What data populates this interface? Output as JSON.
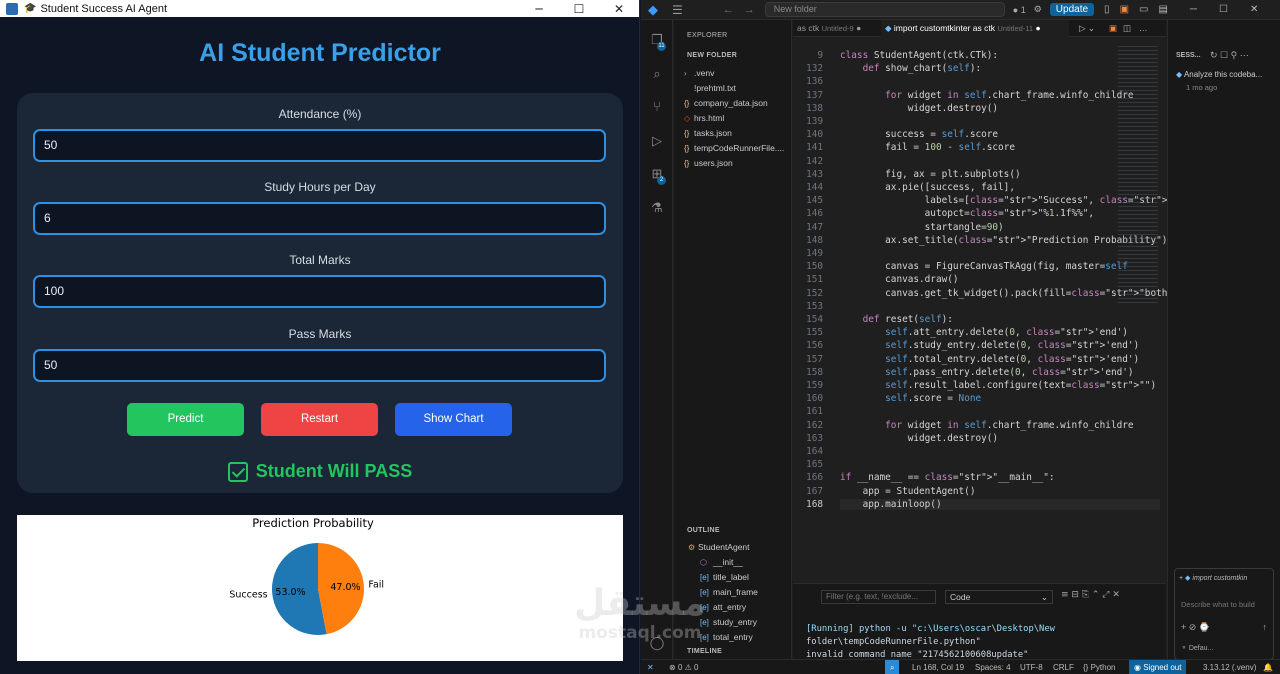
{
  "app": {
    "window_title": "Student Success AI Agent",
    "title": "AI Student Predictor",
    "fields": [
      {
        "label": "Attendance (%)",
        "value": "50"
      },
      {
        "label": "Study Hours per Day",
        "value": "6"
      },
      {
        "label": "Total Marks",
        "value": "100"
      },
      {
        "label": "Pass Marks",
        "value": "50"
      }
    ],
    "buttons": {
      "predict": "Predict",
      "restart": "Restart",
      "chart": "Show Chart"
    },
    "result": "Student Will PASS",
    "colors": {
      "accent": "#3aa0e8",
      "success": "#22c55e",
      "danger": "#ef4444",
      "primary": "#2563eb"
    }
  },
  "chart_data": {
    "type": "pie",
    "title": "Prediction Probability",
    "categories": [
      "Success",
      "Fail"
    ],
    "values": [
      53.0,
      47.0
    ],
    "value_labels": [
      "53.0%",
      "47.0%"
    ],
    "colors": [
      "#1f77b4",
      "#ff7f0e"
    ],
    "startangle": 90
  },
  "vscode": {
    "search": "New folder",
    "update_label": "Update",
    "tabs": [
      {
        "name": "as ctk",
        "sub": "Untitled-9"
      },
      {
        "name": "import customtkinter as ctk",
        "sub": "Untitled-11"
      }
    ],
    "explorer": {
      "header": "EXPLORER",
      "folder": "NEW FOLDER",
      "files": [
        ".venv",
        "!prehtml.txt",
        "company_data.json",
        "hrs.html",
        "tasks.json",
        "tempCodeRunnerFile....",
        "users.json"
      ]
    },
    "outline": {
      "header": "OUTLINE",
      "root": "StudentAgent",
      "items": [
        "__init__",
        "title_label",
        "main_frame",
        "att_entry",
        "study_entry",
        "total_entry"
      ],
      "timeline": "TIMELINE"
    },
    "code_lines": [
      {
        "n": "9",
        "t": "class StudentAgent(ctk.CTk):"
      },
      {
        "n": "132",
        "t": "    def show_chart(self):"
      },
      {
        "n": "136",
        "t": ""
      },
      {
        "n": "137",
        "t": "        for widget in self.chart_frame.winfo_childre"
      },
      {
        "n": "138",
        "t": "            widget.destroy()"
      },
      {
        "n": "139",
        "t": ""
      },
      {
        "n": "140",
        "t": "        success = self.score"
      },
      {
        "n": "141",
        "t": "        fail = 100 - self.score"
      },
      {
        "n": "142",
        "t": ""
      },
      {
        "n": "143",
        "t": "        fig, ax = plt.subplots()"
      },
      {
        "n": "144",
        "t": "        ax.pie([success, fail],"
      },
      {
        "n": "145",
        "t": "               labels=[\"Success\", \"Fail\"],"
      },
      {
        "n": "146",
        "t": "               autopct=\"%1.1f%%\","
      },
      {
        "n": "147",
        "t": "               startangle=90)"
      },
      {
        "n": "148",
        "t": "        ax.set_title(\"Prediction Probability\")"
      },
      {
        "n": "149",
        "t": ""
      },
      {
        "n": "150",
        "t": "        canvas = FigureCanvasTkAgg(fig, master=self"
      },
      {
        "n": "151",
        "t": "        canvas.draw()"
      },
      {
        "n": "152",
        "t": "        canvas.get_tk_widget().pack(fill=\"both\", exp"
      },
      {
        "n": "153",
        "t": ""
      },
      {
        "n": "154",
        "t": "    def reset(self):"
      },
      {
        "n": "155",
        "t": "        self.att_entry.delete(0, 'end')"
      },
      {
        "n": "156",
        "t": "        self.study_entry.delete(0, 'end')"
      },
      {
        "n": "157",
        "t": "        self.total_entry.delete(0, 'end')"
      },
      {
        "n": "158",
        "t": "        self.pass_entry.delete(0, 'end')"
      },
      {
        "n": "159",
        "t": "        self.result_label.configure(text=\"\")"
      },
      {
        "n": "160",
        "t": "        self.score = None"
      },
      {
        "n": "161",
        "t": ""
      },
      {
        "n": "162",
        "t": "        for widget in self.chart_frame.winfo_childre"
      },
      {
        "n": "163",
        "t": "            widget.destroy()"
      },
      {
        "n": "164",
        "t": ""
      },
      {
        "n": "165",
        "t": ""
      },
      {
        "n": "166",
        "t": "if __name__ == \"__main__\":"
      },
      {
        "n": "167",
        "t": "    app = StudentAgent()"
      },
      {
        "n": "168",
        "t": "    app.mainloop()"
      }
    ],
    "terminal": {
      "filter_placeholder": "Filter (e.g. text, !exclude...",
      "select": "Code",
      "lines": [
        "[Running] python -u \"c:\\Users\\oscar\\Desktop\\New",
        "folder\\tempCodeRunnerFile.python\"",
        "invalid command name \"2174562100608update\""
      ]
    },
    "chat": {
      "header": "SESS...",
      "session": "Analyze this codeba...",
      "time": "1 mo ago",
      "chip": "import customtkin",
      "placeholder": "Describe what to build",
      "mode": "Defau..."
    },
    "status": {
      "errors": "0",
      "warnings": "0",
      "position": "Ln 168, Col 19",
      "spaces": "Spaces: 4",
      "encoding": "UTF-8",
      "eol": "CRLF",
      "language": "Python",
      "signed": "Signed out",
      "interpreter": "3.13.12 (.venv)"
    }
  },
  "watermark": {
    "arabic": "مستقل",
    "latin": "mostaql.com"
  }
}
